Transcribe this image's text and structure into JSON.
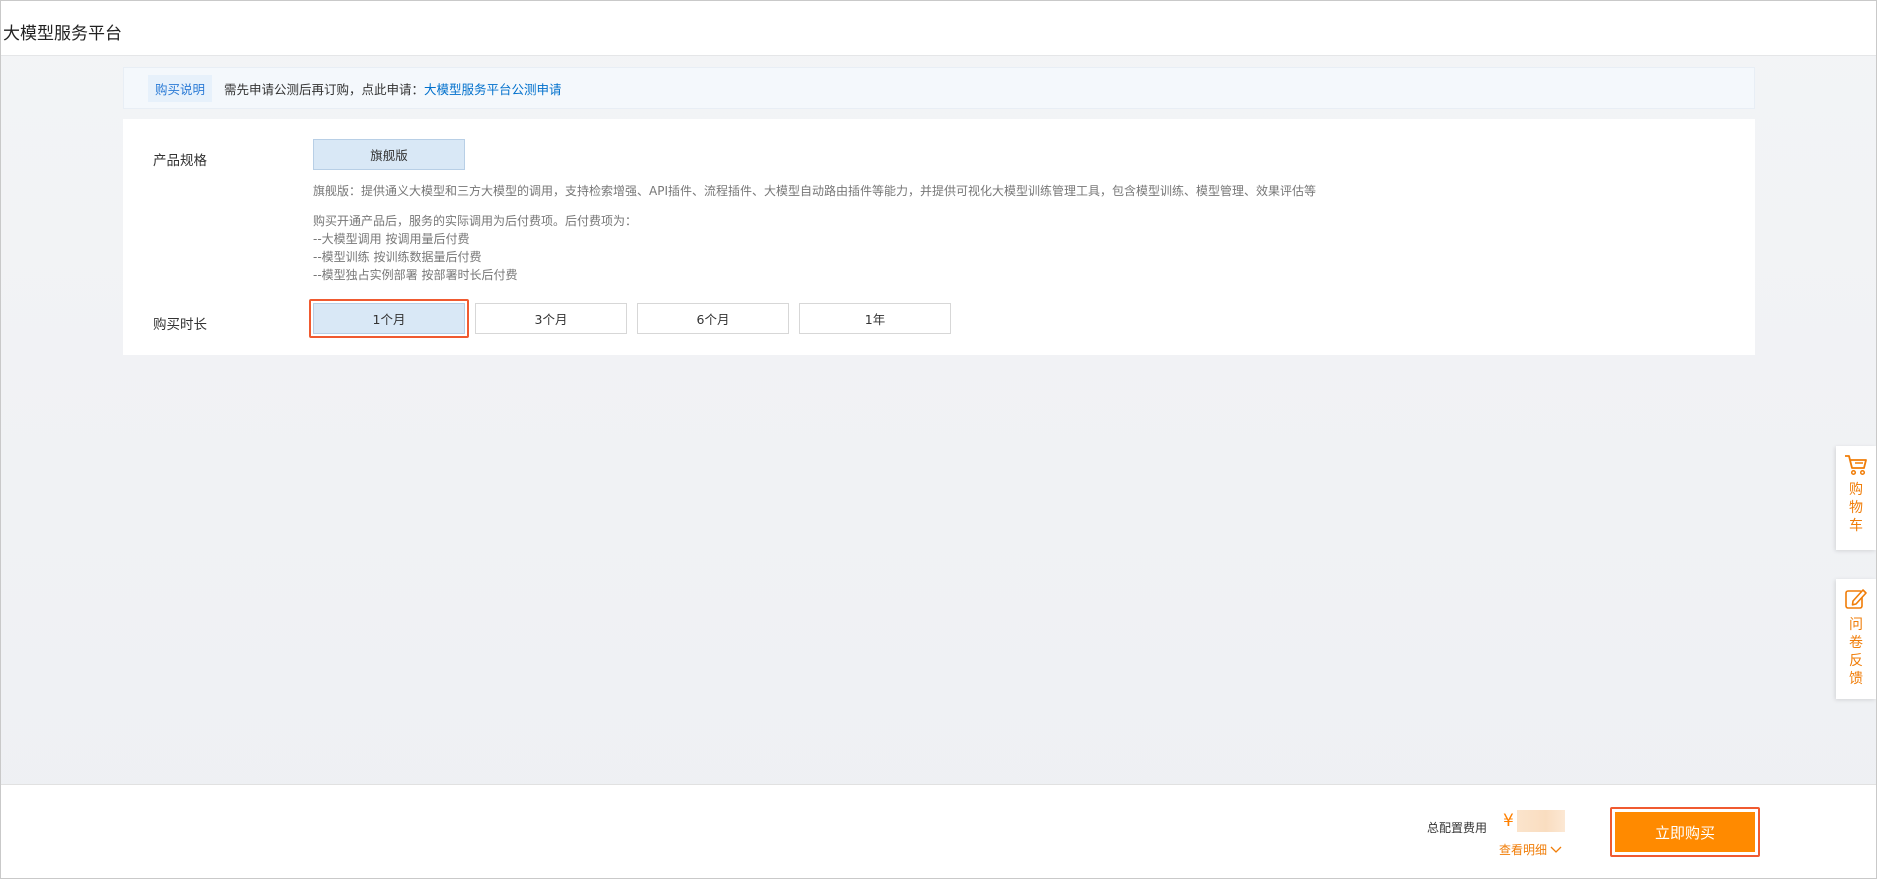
{
  "header": {
    "title": "大模型服务平台"
  },
  "notice": {
    "tag": "购买说明",
    "text": "需先申请公测后再订购，点此申请：",
    "link": "大模型服务平台公测申请"
  },
  "spec": {
    "label": "产品规格",
    "option": "旗舰版",
    "description": "旗舰版：提供通义大模型和三方大模型的调用，支持检索增强、API插件、流程插件、大模型自动路由插件等能力，并提供可视化大模型训练管理工具，包含模型训练、模型管理、效果评估等",
    "billing_lines": [
      "购买开通产品后，服务的实际调用为后付费项。后付费项为：",
      "--大模型调用 按调用量后付费",
      "--模型训练 按训练数据量后付费",
      "--模型独占实例部署 按部署时长后付费"
    ]
  },
  "duration": {
    "label": "购买时长",
    "options": [
      "1个月",
      "3个月",
      "6个月",
      "1年"
    ],
    "selected": "1个月"
  },
  "sidebar": {
    "cart": "购物车",
    "feedback": "问卷反馈"
  },
  "footer": {
    "total_label": "总配置费用",
    "currency": "¥",
    "detail_link": "查看明细",
    "buy_button": "立即购买"
  },
  "colors": {
    "accent_orange": "#ff8a00",
    "link_blue": "#0070cc",
    "selected_bg": "#d9e8f6",
    "highlight_red": "#f05a30"
  }
}
